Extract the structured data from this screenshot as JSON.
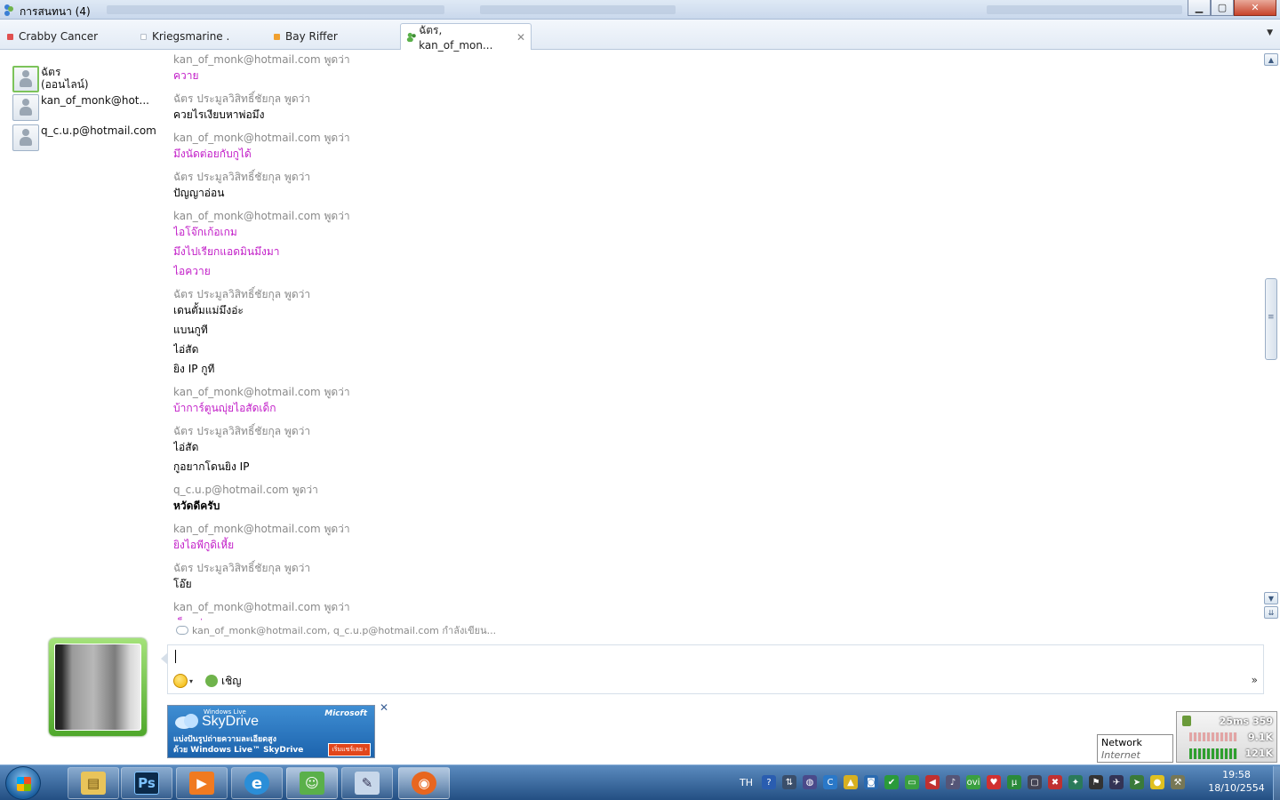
{
  "window": {
    "title": "การสนทนา (4)",
    "controls": {
      "minimize": "▁",
      "maximize": "▢",
      "close": "✕"
    }
  },
  "tabs": [
    {
      "label": "Crabby Cancer",
      "color": "#e05050"
    },
    {
      "label": "Kriegsmarine .",
      "color": "#c8d0da"
    },
    {
      "label": "Bay Riffer",
      "color": "#f0a030"
    },
    {
      "label": "ฉัตร,  kan_of_mon...",
      "color": "#5ab04a",
      "active": true,
      "close": "✕"
    }
  ],
  "tabs_menu": "▼",
  "participants": [
    {
      "name": "ฉัตร",
      "status": "(ออนไลน์)"
    },
    {
      "name": "kan_of_monk@hot..."
    },
    {
      "name": "q_c.u.p@hotmail.com"
    }
  ],
  "conversation": [
    {
      "sender": "kan_of_monk@hotmail.com พูดว่า",
      "messages": [
        "ควาย"
      ],
      "style": "pink"
    },
    {
      "sender": "ฉัตร ประมูลวิสิทธิ์ชัยกุล พูดว่า",
      "messages": [
        "ควยไรเงียบหาพ่อมึง"
      ],
      "style": "normal"
    },
    {
      "sender": "kan_of_monk@hotmail.com พูดว่า",
      "messages": [
        "มึงนัดต่อยกับกูได้"
      ],
      "style": "pink"
    },
    {
      "sender": "ฉัตร ประมูลวิสิทธิ์ชัยกุล พูดว่า",
      "messages": [
        "ปัญญาอ่อน"
      ],
      "style": "normal"
    },
    {
      "sender": "kan_of_monk@hotmail.com พูดว่า",
      "messages": [
        "ไอโจ๊กเก้อเกม",
        "มึงไปเรียกแอดมินมึงมา",
        "ไอควาย"
      ],
      "style": "pink"
    },
    {
      "sender": "ฉัตร ประมูลวิสิทธิ์ชัยกุล พูดว่า",
      "messages": [
        "เดนตั้มแม่มึงอ่ะ",
        "แบนกูที",
        "ไอ่สัด",
        "ยิง IP กูที"
      ],
      "style": "normal"
    },
    {
      "sender": "kan_of_monk@hotmail.com พูดว่า",
      "messages": [
        "บ้าการ์ตูนญุ่ยไอสัดเด็ก"
      ],
      "style": "pink"
    },
    {
      "sender": "ฉัตร ประมูลวิสิทธิ์ชัยกุล พูดว่า",
      "messages": [
        "ไอ่สัด",
        "กูอยากโดนยิง IP"
      ],
      "style": "normal"
    },
    {
      "sender": "q_c.u.p@hotmail.com พูดว่า",
      "messages": [
        "หวัดดีครับ"
      ],
      "style": "bold"
    },
    {
      "sender": "kan_of_monk@hotmail.com พูดว่า",
      "messages": [
        "ยิงไอพีกูดิเหี้ย"
      ],
      "style": "pink"
    },
    {
      "sender": "ฉัตร ประมูลวิสิทธิ์ชัยกุล พูดว่า",
      "messages": [
        "โอ๊ย"
      ],
      "style": "normal"
    },
    {
      "sender": "kan_of_monk@hotmail.com พูดว่า",
      "messages": [
        "เอ็งแม่"
      ],
      "style": "pink"
    }
  ],
  "scrollbar": {
    "up": "▲",
    "down": "▼",
    "end": "⇊",
    "grip": "≡"
  },
  "typing_status": "kan_of_monk@hotmail.com, q_c.u.p@hotmail.com กำลังเขียน...",
  "compose": {
    "value": "",
    "invite_label": "เชิญ",
    "more": "»",
    "dropdown": "▾"
  },
  "ad": {
    "product_small": "Windows Live",
    "product": "SkyDrive",
    "company": "Microsoft",
    "line1": "แบ่งปันรูปถ่ายความละเอียดสูง",
    "line2": "ด้วย Windows Live™ SkyDrive",
    "cta": "เริ่มแชร์เลย ›",
    "close": "✕"
  },
  "network_tooltip": {
    "title": "Network",
    "subtitle": "Internet access"
  },
  "net_meter": {
    "ping": "25ms",
    "count": "359",
    "upload": "9.1K",
    "download": "121K"
  },
  "taskbar": {
    "apps": [
      {
        "name": "file-explorer",
        "glyph": "▤"
      },
      {
        "name": "photoshop",
        "glyph": "Ps"
      },
      {
        "name": "media-player",
        "glyph": "▶"
      },
      {
        "name": "internet-explorer",
        "glyph": "e"
      },
      {
        "name": "messenger",
        "glyph": "☺"
      },
      {
        "name": "paint",
        "glyph": "✎"
      },
      {
        "name": "firefox",
        "glyph": "◉"
      }
    ],
    "language": "TH",
    "tray_icons": [
      "?",
      "⇅",
      "◍",
      "C",
      "▲",
      "◙",
      "✔",
      "▭",
      "◀",
      "♪",
      "ovi",
      "♥",
      "μ",
      "▢",
      "✖",
      "✦",
      "⚑",
      "✈",
      "➤",
      "●",
      "⚒"
    ],
    "time": "19:58",
    "date": "18/10/2554"
  }
}
